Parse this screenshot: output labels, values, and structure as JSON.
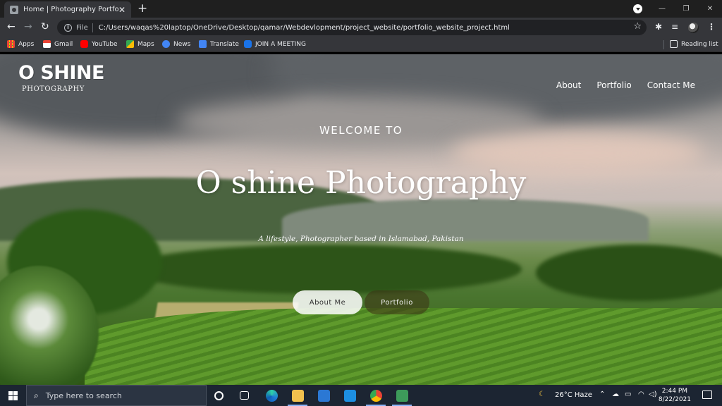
{
  "browser": {
    "tab_title": "Home | Photography Portfolio",
    "tab_close": "✕",
    "new_tab": "+",
    "file_label": "File",
    "url": "C:/Users/waqas%20laptop/OneDrive/Desktop/qamar/Webdevlopment/project_website/portfolio_website_project.html",
    "bookmarks": [
      "Apps",
      "Gmail",
      "YouTube",
      "Maps",
      "News",
      "Translate",
      "JOIN A MEETING"
    ],
    "reading_list": "Reading list",
    "bookmark_colors": [
      "#ea4335",
      "#ffffff",
      "#ff0000",
      "#34a853",
      "#4285f4",
      "#4285f4",
      "#1a73e8"
    ]
  },
  "site": {
    "logo_main": "O SHINE",
    "logo_sub": "PHOTOGRAPHY",
    "nav": [
      "About",
      "Portfolio",
      "Contact Me"
    ],
    "welcome": "WELCOME TO",
    "title": "O shine Photography",
    "tagline": "A lifestyle, Photographer based in Islamabad, Pakistan",
    "buttons": {
      "about": "About Me",
      "portfolio": "Portfolio"
    }
  },
  "taskbar": {
    "search_placeholder": "Type here to search",
    "weather": "26°C  Haze",
    "time": "2:44 PM",
    "date": "8/22/2021"
  }
}
